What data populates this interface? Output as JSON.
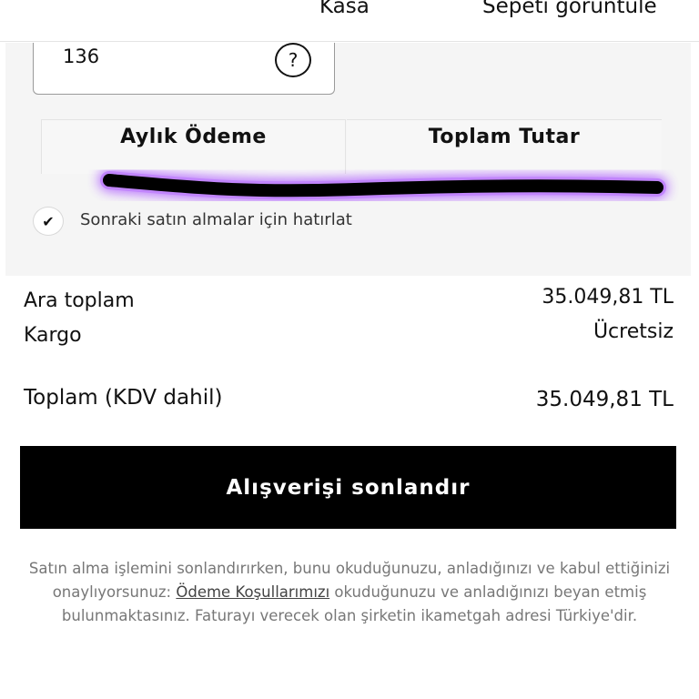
{
  "header": {
    "tab_checkout": "Kasa",
    "tab_view_cart": "Sepeti görüntüle"
  },
  "payment": {
    "cvv_value": "136",
    "help_glyph": "?",
    "segments": [
      "Aylık Ödeme",
      "Toplam Tutar"
    ],
    "scribble_color": "#b060ff",
    "remember_label": "Sonraki satın almalar için hatırlat",
    "check_glyph": "✔"
  },
  "summary": {
    "subtotal_label": "Ara toplam",
    "subtotal_value": "35.049,81 TL",
    "shipping_label": "Kargo",
    "shipping_value": "Ücretsiz",
    "total_label": "Toplam (KDV dahil)",
    "total_value": "35.049,81 TL"
  },
  "cta": {
    "label": "Alışverişi sonlandır"
  },
  "legal": {
    "text_before": "Satın alma işlemini sonlandırırken, bunu okuduğunuzu, anladığınızı ve kabul ettiğinizi onaylıyorsunuz: ",
    "link": "Ödeme Koşullarımızı",
    "text_after": " okuduğunuzu ve anladığınızı beyan etmiş bulunmaktasınız. Faturayı verecek olan şirketin ikametgah adresi Türkiye'dir."
  }
}
